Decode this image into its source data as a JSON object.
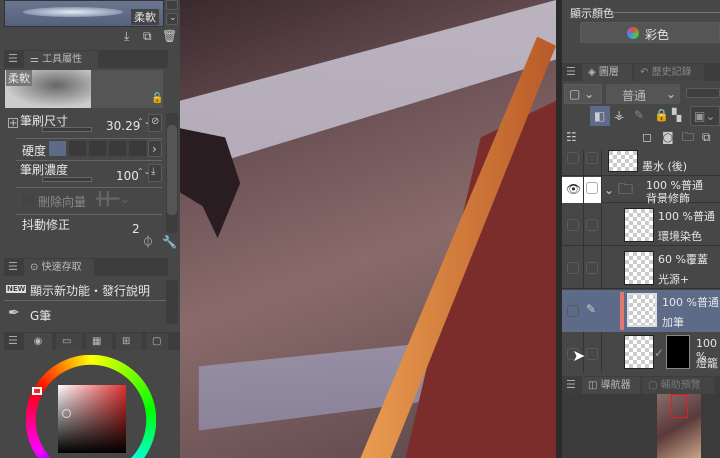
{
  "brush_presets": {
    "selected": "柔軟"
  },
  "tool_property": {
    "tab": "工具屬性",
    "preview_label": "柔軟",
    "brush_size": {
      "label": "筆刷尺寸",
      "value": "30.29"
    },
    "hardness": {
      "label": "硬度",
      "selected_level": 1,
      "levels": 5
    },
    "density": {
      "label": "筆刷濃度",
      "value": "100"
    },
    "vector_erase": {
      "label": "刪除向量"
    },
    "stabilization": {
      "label": "抖動修正",
      "value": "2"
    }
  },
  "quick_access": {
    "tab": "快速存取",
    "items": [
      {
        "label": "顯示新功能・發行說明",
        "badge": "NEW"
      },
      {
        "label": "G筆"
      }
    ]
  },
  "color_panel": {
    "selected_color": "#e0302f"
  },
  "display_color": {
    "label": "顯示顏色",
    "value": "彩色"
  },
  "layers": {
    "tabs": [
      "圖層",
      "歷史記錄"
    ],
    "blend_mode": "普通",
    "items": [
      {
        "blend": "",
        "name": "墨水 (後)"
      },
      {
        "blend": "100 %普通",
        "name": "背景修飾",
        "folder": true,
        "visible": true
      },
      {
        "blend": "100 %普通",
        "name": "環境染色"
      },
      {
        "blend": "60 %覆蓋",
        "name": "光源+"
      },
      {
        "blend": "100 %普通",
        "name": "加筆",
        "selected": true
      },
      {
        "blend": "100 %",
        "name": "燈籠"
      }
    ]
  },
  "navigator": {
    "tabs": [
      "導航器",
      "輔助預覽"
    ]
  }
}
